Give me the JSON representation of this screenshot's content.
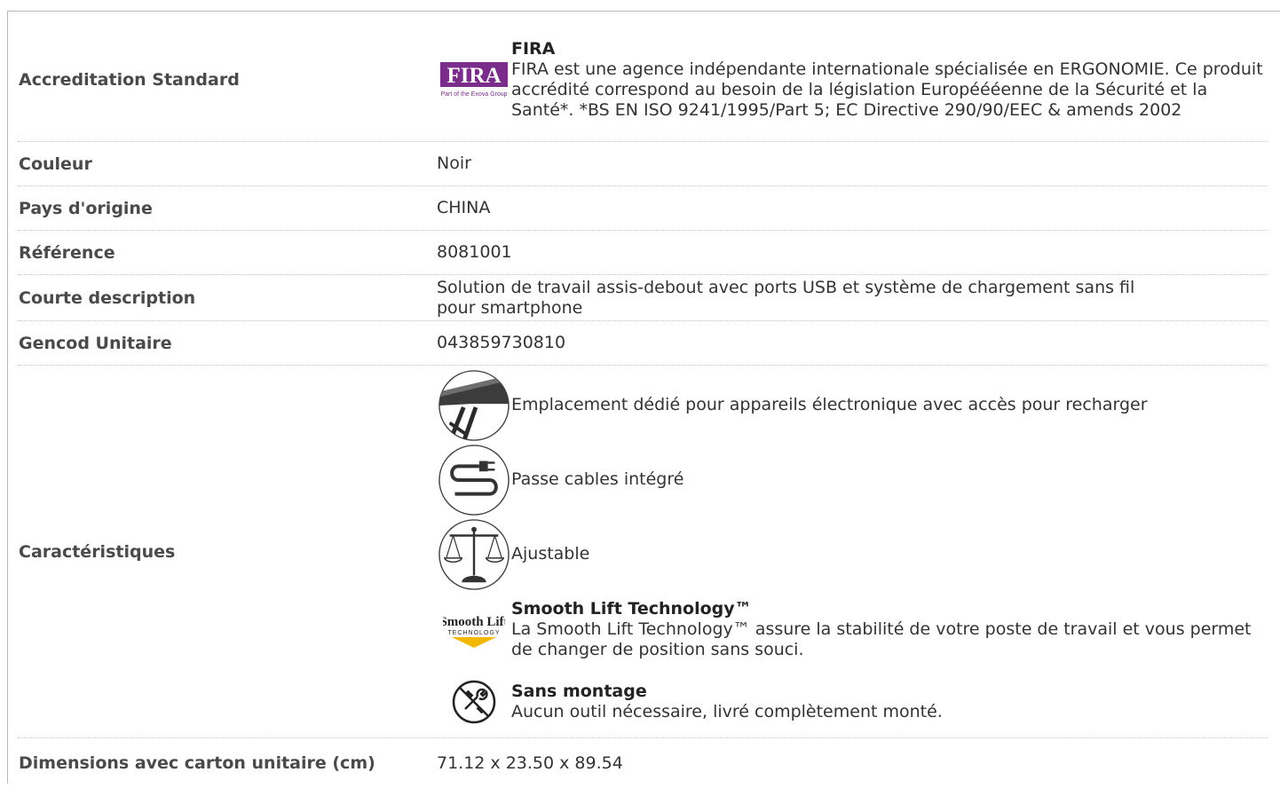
{
  "rows": {
    "accreditation": {
      "label": "Accreditation Standard",
      "logo_text": "FIRA",
      "logo_sub": "Part of the Exova Group",
      "title": "FIRA",
      "text": "FIRA est une agence indépendante internationale spécialisée en ERGONOMIE. Ce produit accrédité correspond au besoin de la législation Européééenne de la Sécurité et la Santé*. *BS EN ISO 9241/1995/Part 5; EC Directive 290/90/EEC & amends 2002"
    },
    "couleur": {
      "label": "Couleur",
      "value": "Noir"
    },
    "pays": {
      "label": "Pays d'origine",
      "value": "CHINA"
    },
    "reference": {
      "label": "Référence",
      "value": "8081001"
    },
    "courte": {
      "label": "Courte description",
      "value": "Solution de travail assis-debout avec ports USB et système de chargement sans fil pour smartphone"
    },
    "gencod": {
      "label": "Gencod Unitaire",
      "value": "043859730810"
    },
    "caracteristiques": {
      "label": "Caractéristiques",
      "features": [
        {
          "icon": "desk-platform-icon",
          "text": "Emplacement dédié pour appareils électronique avec accès pour recharger"
        },
        {
          "icon": "cable-plug-icon",
          "text": "Passe cables intégré"
        },
        {
          "icon": "balance-scale-icon",
          "text": "Ajustable"
        },
        {
          "icon": "smooth-lift-logo",
          "logo_line1": "Smooth Lift",
          "logo_line2": "TECHNOLOGY",
          "title": "Smooth Lift Technology™",
          "text": "La Smooth Lift Technology™ assure la stabilité de votre poste de travail et vous permet de changer de position sans souci."
        },
        {
          "icon": "no-tools-icon",
          "title": "Sans montage",
          "text": "Aucun outil nécessaire, livré complètement monté."
        }
      ]
    },
    "dimensions": {
      "label": "Dimensions avec carton unitaire (cm)",
      "value": "71.12 x 23.50 x 89.54"
    }
  },
  "colors": {
    "fira_purple": "#7b2d8b",
    "smooth_lift_yellow": "#f2b800",
    "text": "#333333",
    "label": "#4a4a4a"
  }
}
